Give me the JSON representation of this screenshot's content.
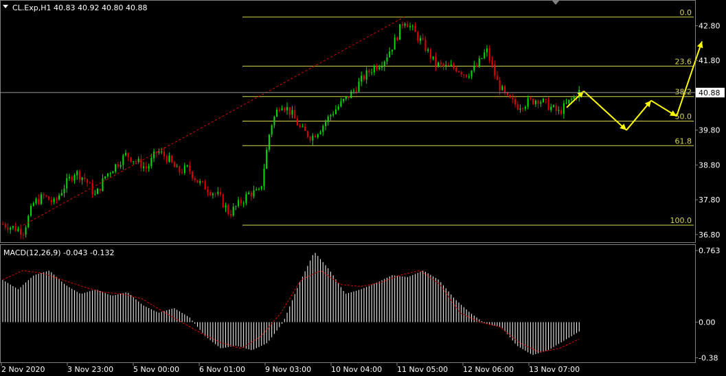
{
  "header": {
    "symbol_line": "CL.Exp,H1  40.83 40.92 40.80 40.88",
    "macd_line": "MACD(12,26,9) -0.043 -0.132"
  },
  "colors": {
    "background": "#000000",
    "bull": "#00e000",
    "bear": "#e00000",
    "fib": "#d8d84a",
    "arrows": "#ffff00",
    "macd_hist": "#ffffff",
    "macd_signal": "#e00000",
    "grid": "#808080"
  },
  "chart_data": [
    {
      "type": "candlestick",
      "title": "CL.Exp,H1",
      "ohlc_last": {
        "open": 40.83,
        "high": 40.92,
        "low": 40.8,
        "close": 40.88
      },
      "ylim": [
        36.6,
        43.5
      ],
      "y_ticks": [
        "42.80",
        "41.80",
        "39.80",
        "38.80",
        "37.80",
        "36.80"
      ],
      "current_price_label": "40.88",
      "x_ticks": [
        "2 Nov 2020",
        "3 Nov 23:00",
        "5 Nov 00:00",
        "6 Nov 01:00",
        "9 Nov 03:00",
        "10 Nov 04:00",
        "11 Nov 05:00",
        "12 Nov 06:00",
        "13 Nov 07:00"
      ],
      "price_path": [
        37.1,
        37.0,
        36.9,
        37.7,
        37.9,
        37.7,
        38.2,
        38.6,
        38.4,
        37.9,
        38.5,
        38.8,
        39.1,
        38.9,
        38.7,
        39.2,
        39.0,
        38.6,
        38.7,
        38.3,
        38.1,
        37.9,
        37.4,
        37.7,
        38.0,
        38.0,
        39.9,
        40.6,
        40.3,
        39.8,
        39.6,
        39.9,
        40.3,
        40.6,
        40.9,
        41.3,
        41.6,
        41.8,
        42.3,
        43.0,
        42.6,
        42.2,
        41.7,
        41.6,
        41.6,
        41.4,
        41.6,
        42.1,
        41.2,
        40.7,
        40.5,
        40.6,
        40.7,
        40.5,
        40.3,
        40.6,
        40.9
      ],
      "forecast_path": [
        40.45,
        40.92,
        39.8,
        40.65,
        40.2,
        42.35
      ],
      "fibonacci": {
        "levels": [
          "0.0",
          "23.6",
          "38.2",
          "50.0",
          "61.8",
          "100.0"
        ],
        "high": 43.05,
        "low": 37.07
      }
    },
    {
      "type": "macd",
      "title": "MACD(12,26,9)",
      "values": {
        "macd": -0.043,
        "signal": -0.132
      },
      "ylim": [
        -0.42,
        0.8
      ],
      "y_ticks": [
        "0.763",
        "0.00",
        "-0.38"
      ],
      "histogram_path": [
        0.45,
        0.35,
        0.5,
        0.55,
        0.4,
        0.3,
        0.35,
        0.28,
        0.32,
        0.18,
        0.1,
        0.15,
        0.05,
        -0.15,
        -0.28,
        -0.25,
        -0.3,
        -0.22,
        0.0,
        0.4,
        0.75,
        0.55,
        0.3,
        0.35,
        0.42,
        0.5,
        0.48,
        0.55,
        0.45,
        0.25,
        0.1,
        -0.02,
        -0.05,
        -0.25,
        -0.35,
        -0.3,
        -0.2,
        -0.1
      ],
      "signal_path": [
        0.45,
        0.55,
        0.52,
        0.45,
        0.38,
        0.32,
        0.3,
        0.25,
        0.12,
        0.0,
        -0.12,
        -0.22,
        -0.28,
        -0.15,
        0.1,
        0.45,
        0.55,
        0.4,
        0.38,
        0.42,
        0.5,
        0.55,
        0.4,
        0.1,
        0.0,
        -0.05,
        -0.22,
        -0.32,
        -0.28,
        -0.18
      ]
    }
  ]
}
